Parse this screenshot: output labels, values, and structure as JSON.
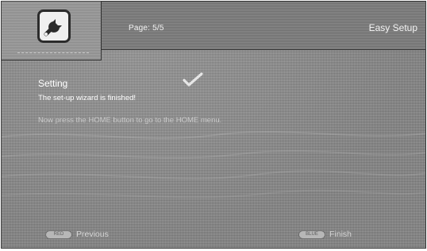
{
  "header": {
    "page_indicator": "Page: 5/5",
    "title": "Easy Setup"
  },
  "icon": {
    "name": "setup-wrench-icon"
  },
  "content": {
    "heading": "Setting",
    "message": "The set-up wizard is finished!",
    "instruction": "Now press the HOME button to go to the HOME menu."
  },
  "footer": {
    "previous_key": "RED",
    "previous_label": "Previous",
    "finish_key": "BLUE",
    "finish_label": "Finish"
  }
}
